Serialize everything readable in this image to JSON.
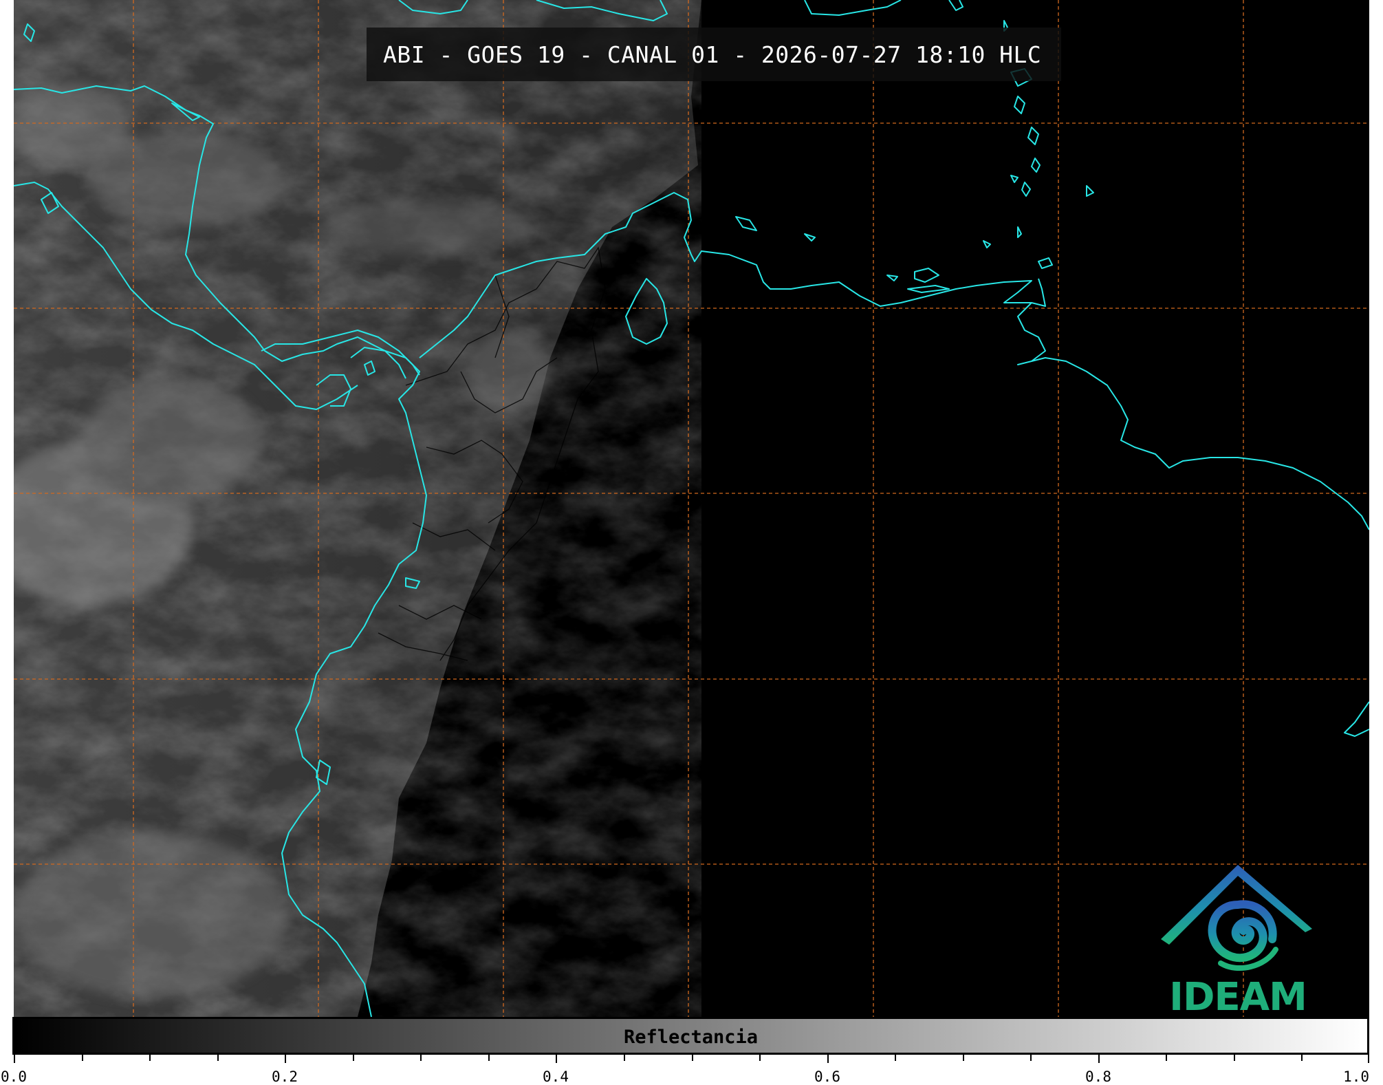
{
  "title": "ABI - GOES 19 - CANAL 01 - 2026-07-27 18:10 HLC",
  "colorbar": {
    "label": "Reflectancia",
    "range": [
      0.0,
      1.0
    ],
    "colormap": "grayscale black-to-white",
    "tick_labels": [
      "0.0",
      "0.2",
      "0.4",
      "0.6",
      "0.8",
      "1.0"
    ],
    "minor_ticks_between": 3
  },
  "logo": {
    "text": "IDEAM"
  },
  "colors": {
    "coastline": "#28e6e6",
    "grid": "#d2691e",
    "borders": "#000000",
    "night_side": "#000000"
  },
  "map": {
    "graticule": "dashed",
    "projection_note": "Colombia and neighboring region"
  }
}
